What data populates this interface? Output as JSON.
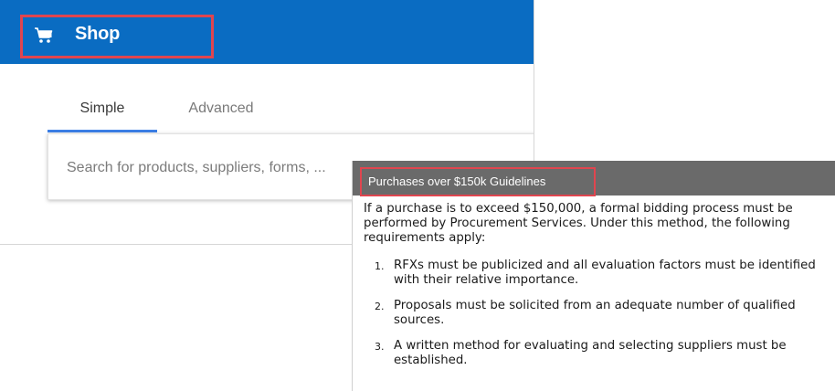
{
  "shop": {
    "title": "Shop",
    "cart_icon": "shopping-cart-icon",
    "tabs": [
      {
        "label": "Simple",
        "active": true
      },
      {
        "label": "Advanced",
        "active": false
      }
    ],
    "search": {
      "placeholder": "Search for products, suppliers, forms, ..."
    }
  },
  "guidelines": {
    "title": "Purchases over $150k Guidelines",
    "intro": "If a purchase is to exceed $150,000, a formal bidding process must be performed by Procurement Services. Under this method, the following requirements apply:",
    "items": [
      {
        "num": "1.",
        "text": "RFXs must be publicized and all evaluation factors must be identified with their relative importance."
      },
      {
        "num": "2.",
        "text": "Proposals must be solicited from an adequate number of qualified sources."
      },
      {
        "num": "3.",
        "text": "A written method for evaluating and selecting suppliers must be established."
      }
    ]
  },
  "colors": {
    "shop_header": "#0a6cc2",
    "highlight_border": "#e0454f",
    "tab_active": "#3c7fe6",
    "guide_header": "#6a6a6a"
  }
}
